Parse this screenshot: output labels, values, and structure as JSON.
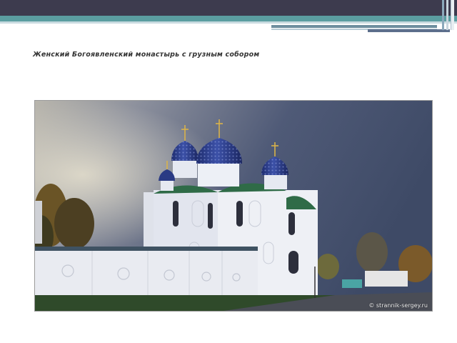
{
  "slide": {
    "title": "Женский Богоявленский монастырь с грузным собором"
  },
  "photo": {
    "watermark": "© strannik-sergey.ru"
  },
  "colors": {
    "topbar_dark": "#3d3b4e",
    "topbar_teal": "#5b9da0",
    "dome_blue": "#2e3f8f",
    "roof_green": "#2f6b47",
    "sky": "#5d6a84",
    "wall_white": "#eef0f5"
  }
}
